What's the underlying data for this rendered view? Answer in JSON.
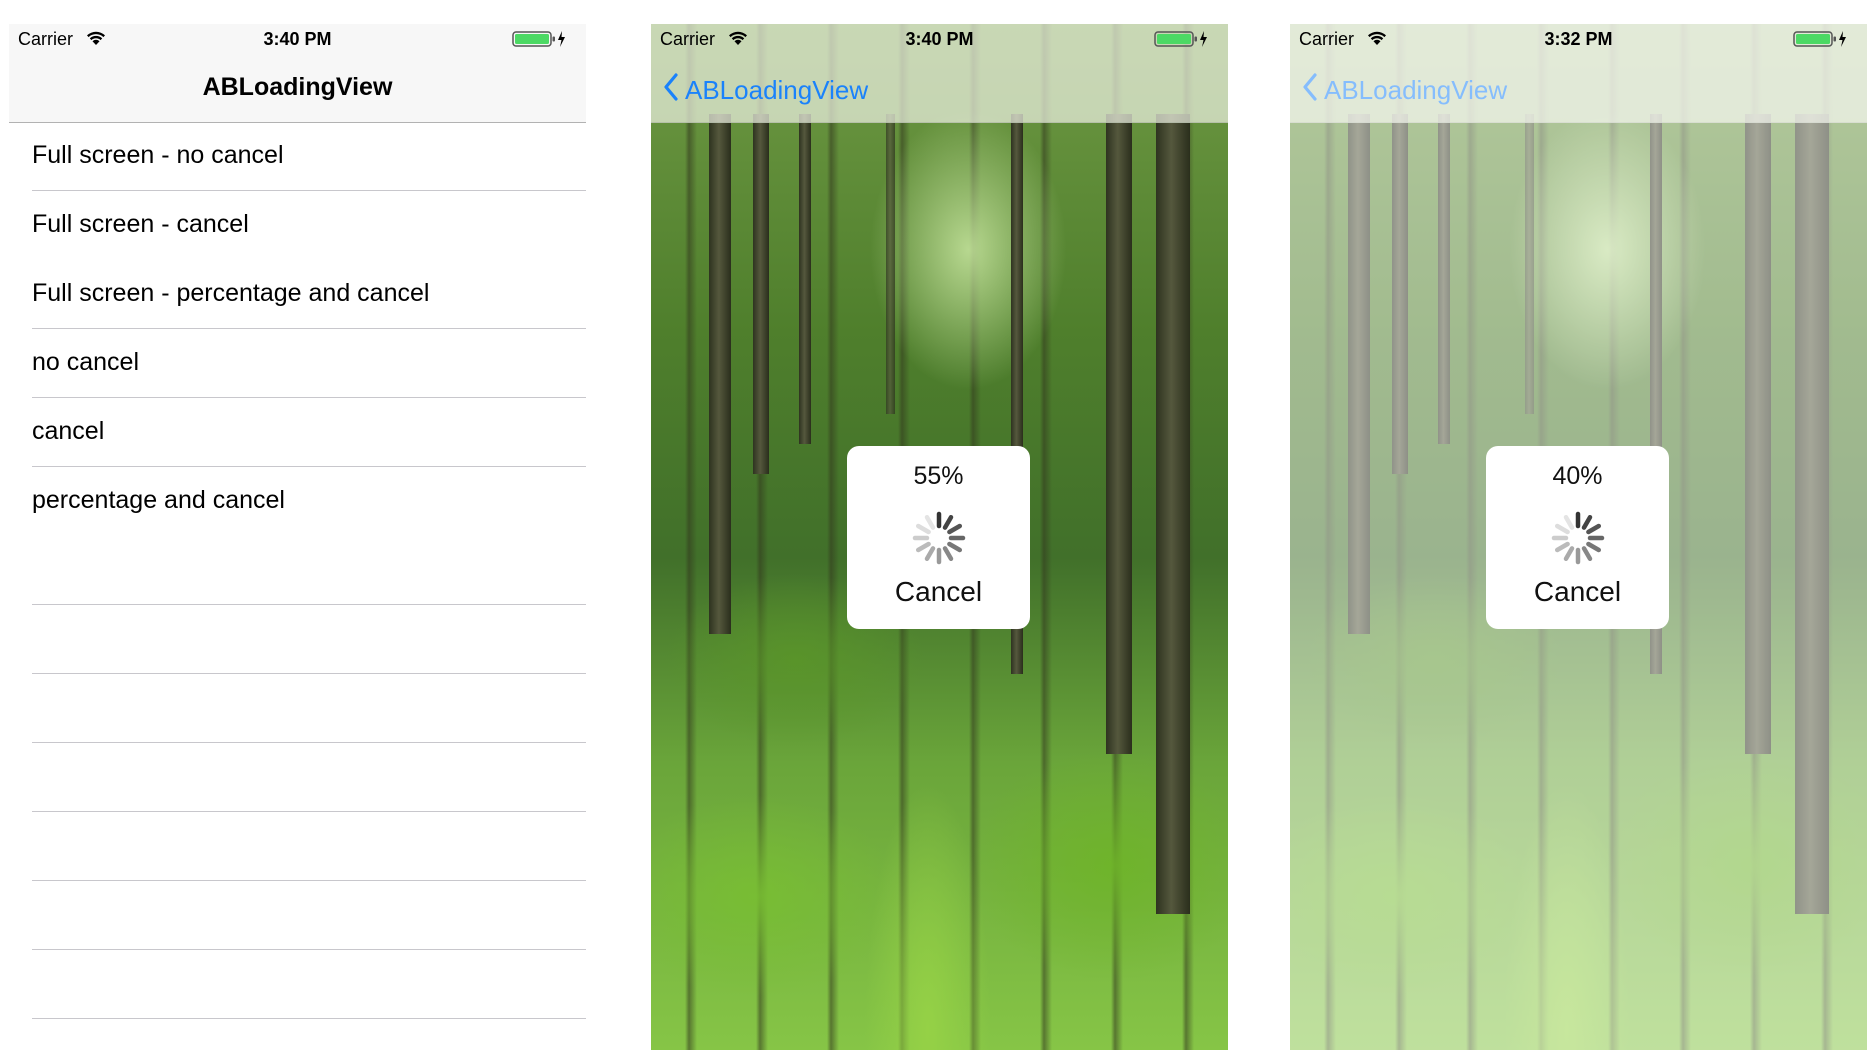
{
  "screens": [
    {
      "status": {
        "carrier": "Carrier",
        "time": "3:40 PM"
      },
      "nav": {
        "title": "ABLoadingView"
      },
      "rows": [
        "Full screen - no cancel",
        "Full screen - cancel",
        "Full screen - percentage and cancel",
        "no cancel",
        "cancel",
        "percentage and cancel"
      ]
    },
    {
      "status": {
        "carrier": "Carrier",
        "time": "3:40 PM"
      },
      "nav": {
        "back_label": "ABLoadingView"
      },
      "loading": {
        "percent": "55%",
        "cancel_label": "Cancel"
      }
    },
    {
      "status": {
        "carrier": "Carrier",
        "time": "3:32 PM"
      },
      "nav": {
        "back_label": "ABLoadingView"
      },
      "loading": {
        "percent": "40%",
        "cancel_label": "Cancel"
      }
    }
  ],
  "icons": {
    "wifi": "wifi-icon",
    "battery": "battery-charging-icon",
    "back": "chevron-left-icon",
    "spinner": "activity-indicator-icon"
  },
  "colors": {
    "accent": "#1a82fb",
    "battery": "#4cd964",
    "separator": "#c8c7cc"
  }
}
